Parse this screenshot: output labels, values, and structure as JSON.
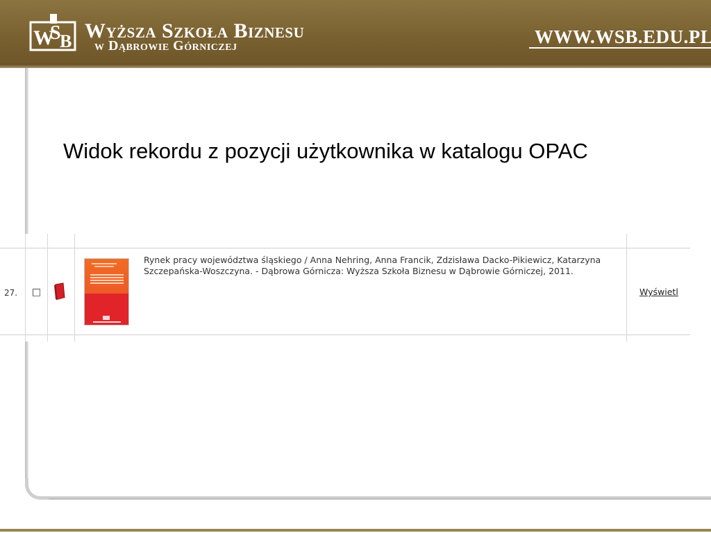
{
  "header": {
    "school_name": "Wyższa Szkoła Biznesu",
    "school_location": "w Dąbrowie Górniczej",
    "site_url": "WWW.WSB.EDU.PL",
    "colors": {
      "banner": "#7a6131",
      "text": "#ffffff"
    },
    "logo_icon": "wsb-logo-icon"
  },
  "slide": {
    "title": "Widok rekordu z pozycji użytkownika w katalogu OPAC"
  },
  "result": {
    "number": "27.",
    "checked": false,
    "format_icon": "book-icon",
    "record": "Rynek pracy województwa śląskiego / Anna Nehring, Anna Francik, Zdzisława Dacko-Pikiewicz, Katarzyna Szczepańska-Woszczyna. - Dąbrowa Górnicza: Wyższa Szkoła Biznesu w Dąbrowie Górniczej, 2011.",
    "show_label": "Wyświetl",
    "cover_colors": {
      "top": "#ef6325",
      "bottom": "#e0242a"
    }
  }
}
